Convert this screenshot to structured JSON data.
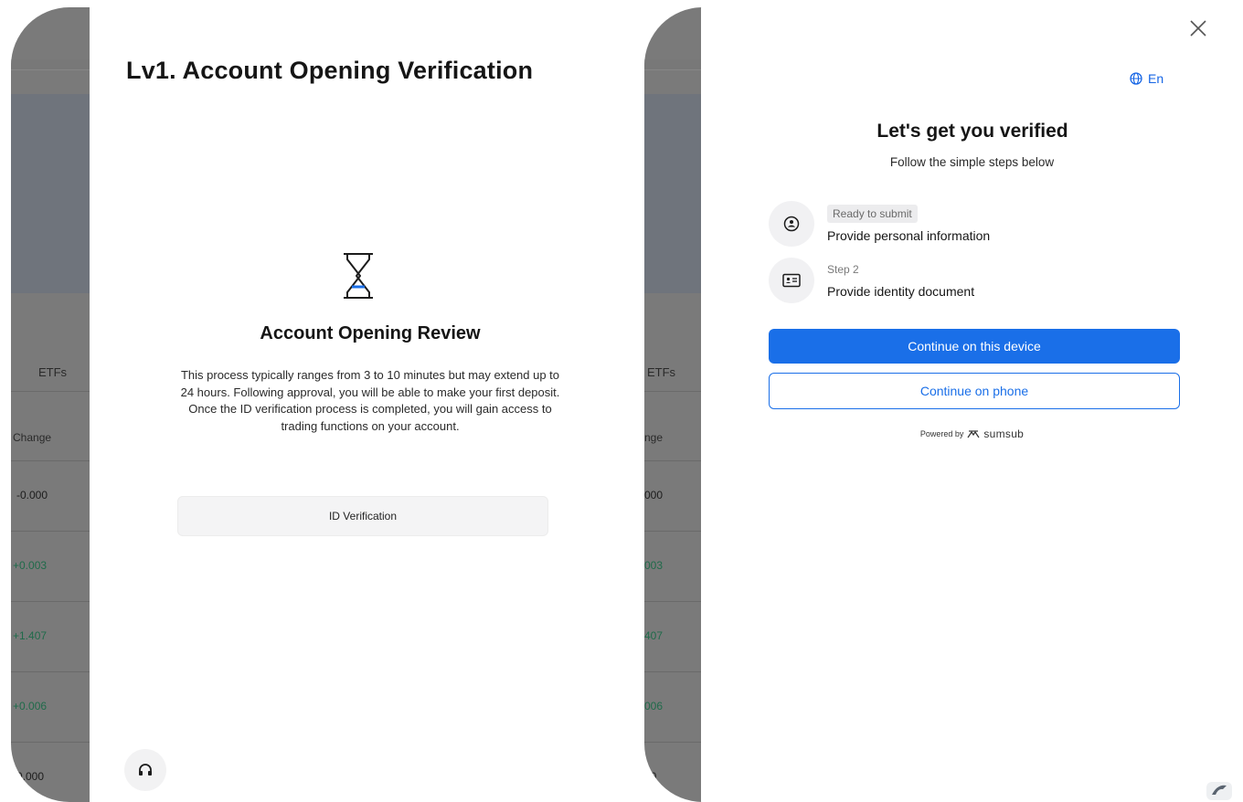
{
  "left_panel": {
    "background": {
      "tab_label": "ETFs",
      "column_header": "Change",
      "values": [
        {
          "text": "-0.000",
          "kind": "neutral"
        },
        {
          "text": "+0.003",
          "kind": "positive"
        },
        {
          "text": "+1.407",
          "kind": "positive"
        },
        {
          "text": "+0.006",
          "kind": "positive"
        },
        {
          "text": "-0.000",
          "kind": "neutral"
        }
      ]
    },
    "modal": {
      "title": "Lv1. Account Opening Verification",
      "icon": "hourglass-icon",
      "review_title": "Account Opening Review",
      "review_text": "This process typically ranges from 3 to 10 minutes but may extend up to 24 hours. Following approval, you will be able to make your first deposit. Once the ID verification process is completed, you will gain access to trading functions on your account.",
      "id_button_label": "ID Verification",
      "support_icon": "headset-icon"
    }
  },
  "right_panel": {
    "background": {
      "tab_label": "ETFs",
      "column_header": "nge",
      "values": [
        {
          "text": "000",
          "kind": "neutral"
        },
        {
          "text": "003",
          "kind": "positive"
        },
        {
          "text": "407",
          "kind": "positive"
        },
        {
          "text": "006",
          "kind": "positive"
        },
        {
          "text": "00",
          "kind": "neutral"
        }
      ]
    },
    "modal": {
      "language": "En",
      "title": "Let's get you verified",
      "subtitle": "Follow the simple steps below",
      "steps": [
        {
          "badge": "Ready to submit",
          "title": "Provide personal information",
          "icon": "person-icon"
        },
        {
          "label": "Step 2",
          "title": "Provide identity document",
          "icon": "id-card-icon"
        }
      ],
      "primary_button": "Continue on this device",
      "secondary_button": "Continue on phone",
      "powered_by": "Powered by",
      "brand": "sumsub"
    }
  },
  "colors": {
    "accent": "#1a6fe8",
    "positive": "#1f6b4a",
    "overlay": "#7a7a7a"
  }
}
